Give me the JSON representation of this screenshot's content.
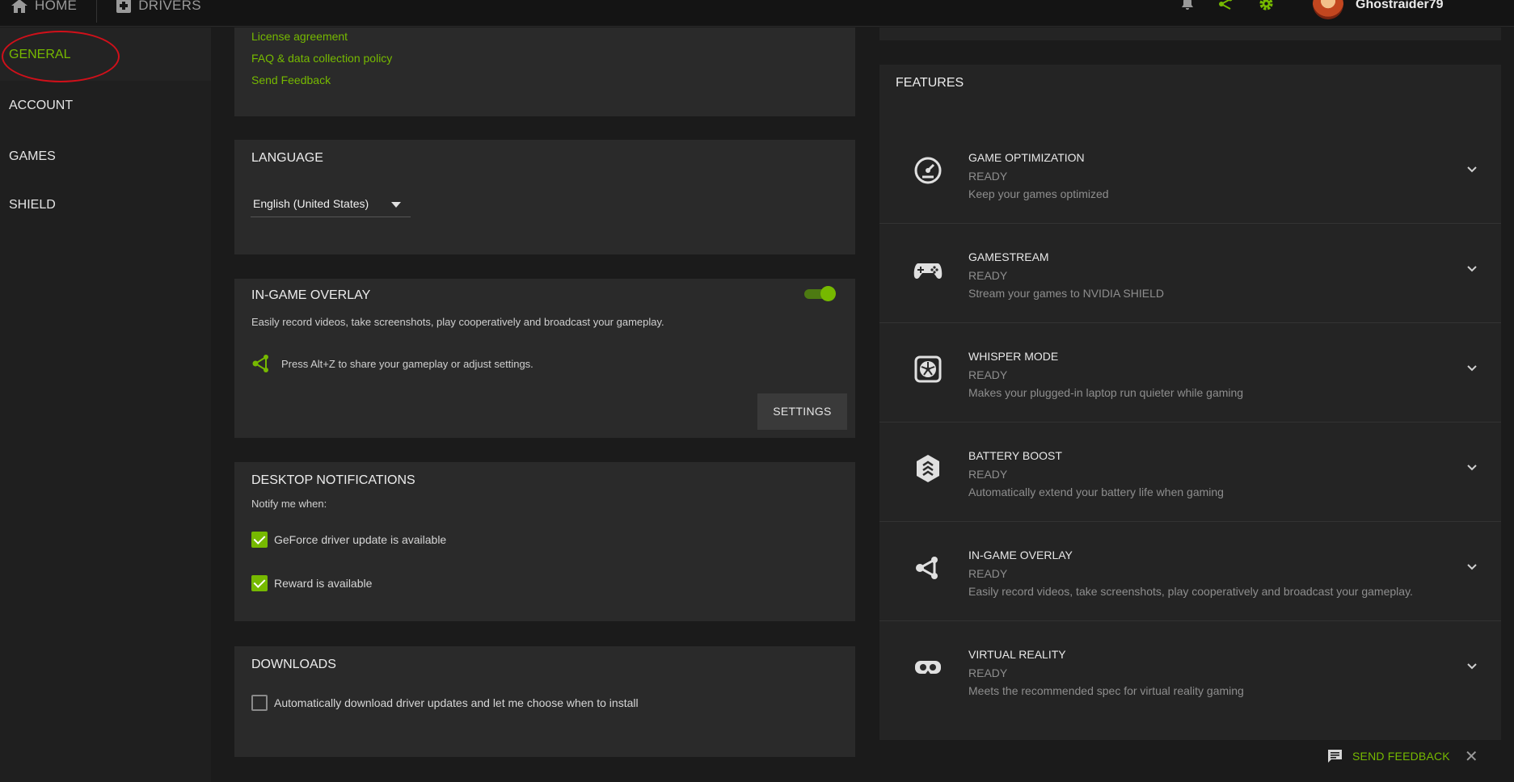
{
  "topbar": {
    "home_label": "HOME",
    "drivers_label": "DRIVERS",
    "username": "Ghostraider79"
  },
  "sidebar": {
    "items": [
      {
        "label": "GENERAL",
        "active": true
      },
      {
        "label": "ACCOUNT",
        "active": false
      },
      {
        "label": "GAMES",
        "active": false
      },
      {
        "label": "SHIELD",
        "active": false
      }
    ]
  },
  "about": {
    "links": [
      "License agreement",
      "FAQ & data collection policy",
      "Send Feedback"
    ]
  },
  "language": {
    "title": "LANGUAGE",
    "selected": "English (United States)"
  },
  "overlay": {
    "title": "IN-GAME OVERLAY",
    "enabled": true,
    "description": "Easily record videos, take screenshots, play cooperatively and broadcast your gameplay.",
    "hint": "Press Alt+Z to share your gameplay or adjust settings.",
    "settings_label": "SETTINGS"
  },
  "notifications": {
    "title": "DESKTOP NOTIFICATIONS",
    "subtitle": "Notify me when:",
    "options": [
      {
        "label": "GeForce driver update is available",
        "checked": true
      },
      {
        "label": "Reward is available",
        "checked": true
      }
    ]
  },
  "downloads": {
    "title": "DOWNLOADS",
    "option": {
      "label": "Automatically download driver updates and let me choose when to install",
      "checked": false
    }
  },
  "features": {
    "title": "FEATURES",
    "items": [
      {
        "name": "GAME OPTIMIZATION",
        "status": "READY",
        "desc": "Keep your games optimized",
        "icon": "speedometer-icon"
      },
      {
        "name": "GAMESTREAM",
        "status": "READY",
        "desc": "Stream your games to NVIDIA SHIELD",
        "icon": "gamepad-icon"
      },
      {
        "name": "WHISPER MODE",
        "status": "READY",
        "desc": "Makes your plugged-in laptop run quieter while gaming",
        "icon": "fan-icon"
      },
      {
        "name": "BATTERY BOOST",
        "status": "READY",
        "desc": "Automatically extend your battery life when gaming",
        "icon": "battery-boost-icon"
      },
      {
        "name": "IN-GAME OVERLAY",
        "status": "READY",
        "desc": "Easily record videos, take screenshots, play cooperatively and broadcast your gameplay.",
        "icon": "share-icon"
      },
      {
        "name": "VIRTUAL REALITY",
        "status": "READY",
        "desc": "Meets the recommended spec for virtual reality gaming",
        "icon": "vr-headset-icon"
      }
    ]
  },
  "feedback": {
    "label": "SEND FEEDBACK",
    "close": "✕"
  },
  "colors": {
    "accent": "#76b900",
    "annotation": "#d0101a"
  }
}
